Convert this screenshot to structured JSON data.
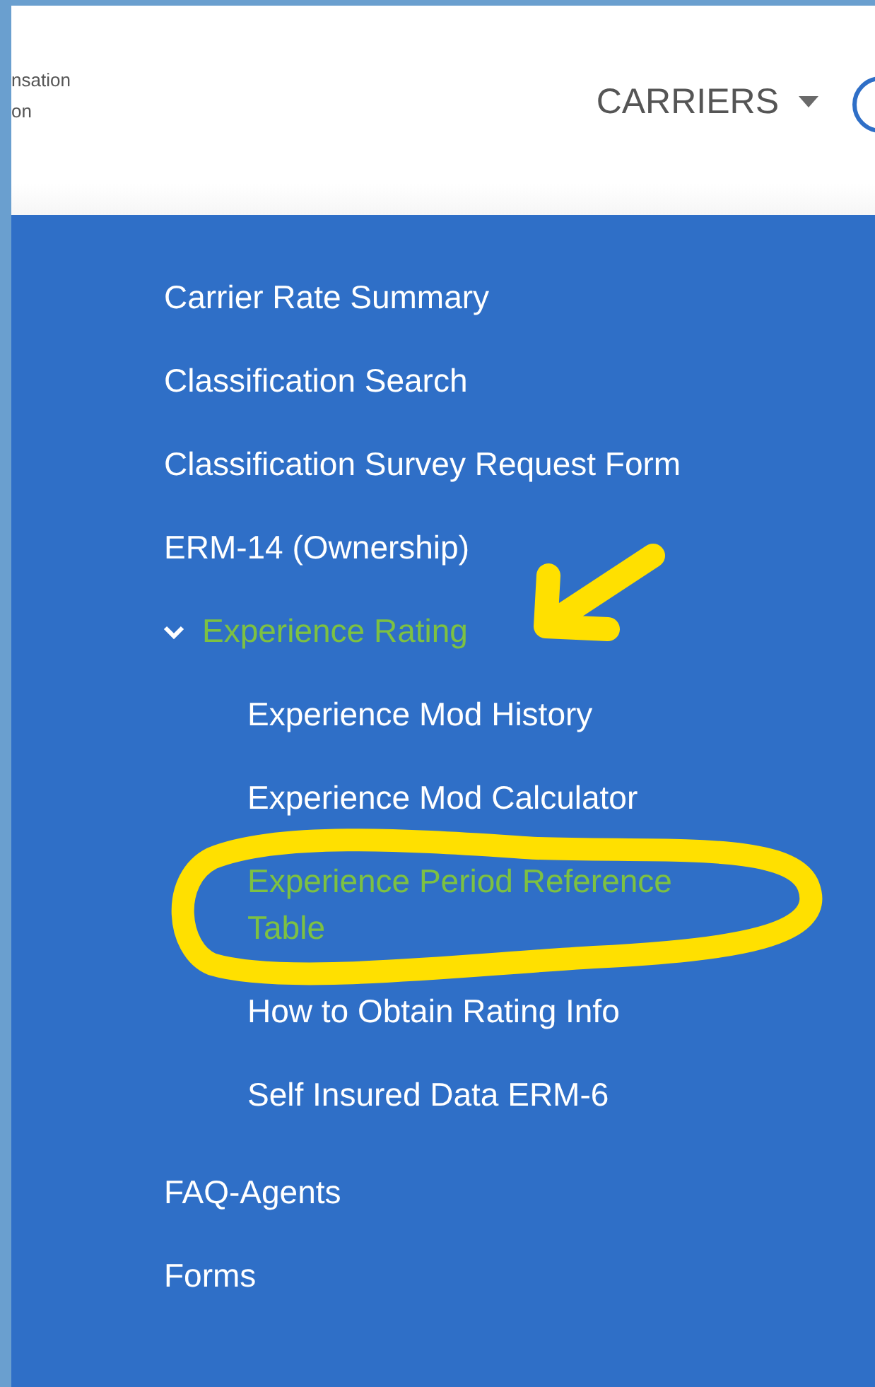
{
  "header": {
    "logo_text": [
      "nsation",
      "on"
    ],
    "nav": [
      {
        "label": "CARRIERS",
        "has_dropdown": true
      }
    ]
  },
  "menu": [
    {
      "label": "Carrier Rate Summary",
      "selected": false
    },
    {
      "label": "Classification Search",
      "selected": false
    },
    {
      "label": "Classification Survey Request Form",
      "selected": false
    },
    {
      "label": "ERM-14 (Ownership)",
      "selected": false
    },
    {
      "label": "Experience Rating",
      "selected": true,
      "expanded": true,
      "children": [
        {
          "label": "Experience Mod History",
          "selected": false
        },
        {
          "label": "Experience Mod Calculator",
          "selected": false
        },
        {
          "label": "Experience Period Reference Table",
          "selected": true
        },
        {
          "label": "How to Obtain Rating Info",
          "selected": false
        },
        {
          "label": "Self Insured Data ERM-6",
          "selected": false
        }
      ]
    },
    {
      "label": "FAQ-Agents",
      "selected": false
    },
    {
      "label": "Forms",
      "selected": false
    }
  ]
}
